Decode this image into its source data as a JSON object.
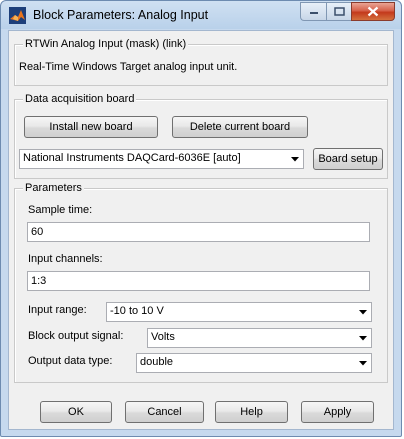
{
  "window": {
    "title": "Block Parameters: Analog Input"
  },
  "mask": {
    "legend": "RTWin Analog Input (mask) (link)",
    "description": "Real-Time Windows Target analog input unit."
  },
  "board_group": {
    "legend": "Data acquisition board",
    "install_label": "Install new board",
    "delete_label": "Delete current board",
    "board_selected": "National Instruments DAQCard-6036E [auto]",
    "setup_label": "Board setup"
  },
  "params": {
    "legend": "Parameters",
    "sample_time_label": "Sample time:",
    "sample_time_value": "60",
    "input_channels_label": "Input channels:",
    "input_channels_value": "1:3",
    "input_range_label": "Input range:",
    "input_range_value": "-10 to 10 V",
    "output_signal_label": "Block output signal:",
    "output_signal_value": "Volts",
    "output_type_label": "Output data type:",
    "output_type_value": "double"
  },
  "buttons": {
    "ok": "OK",
    "cancel": "Cancel",
    "help": "Help",
    "apply": "Apply"
  },
  "colors": {
    "title_bar": "#b9d1ea",
    "close_button": "#c3391c",
    "dialog_bg": "#f0f0f0"
  }
}
